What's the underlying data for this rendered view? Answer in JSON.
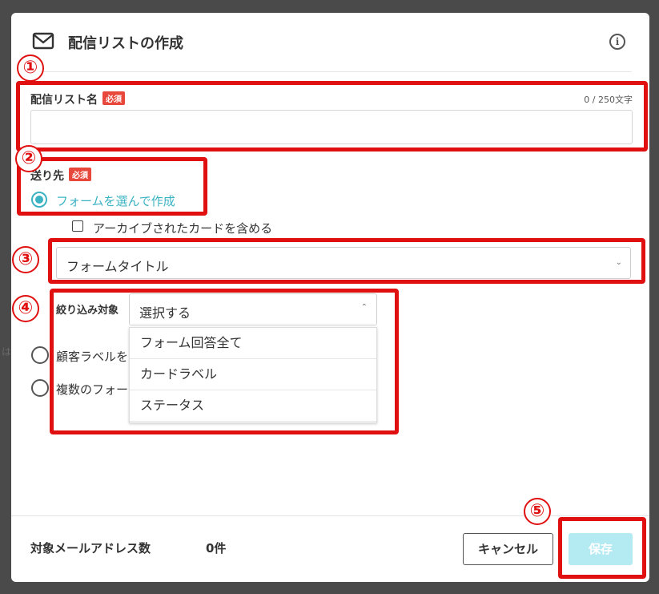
{
  "modal": {
    "title": "配信リストの作成",
    "icons": {
      "header": "mail-icon",
      "info": "info-icon"
    }
  },
  "list_name": {
    "label": "配信リスト名",
    "required_badge": "必須",
    "counter": "0 / 250文字",
    "value": ""
  },
  "recipients": {
    "label": "送り先",
    "required_badge": "必須",
    "options": [
      {
        "label": "フォームを選んで作成",
        "selected": true
      },
      {
        "label": "顧客ラベルを",
        "selected": false
      },
      {
        "label": "複数のフォー",
        "selected": false
      }
    ],
    "archive_checkbox": {
      "label": "アーカイブされたカードを含める",
      "checked": false
    }
  },
  "form_select": {
    "value": "フォームタイトル"
  },
  "filter": {
    "label": "絞り込み対象",
    "selected": "選択する",
    "options": [
      "フォーム回答全て",
      "カードラベル",
      "ステータス"
    ]
  },
  "footer": {
    "count_label": "対象メールアドレス数",
    "count_value": "0件",
    "cancel_label": "キャンセル",
    "save_label": "保存"
  },
  "annotations": [
    "①",
    "②",
    "③",
    "④",
    "⑤"
  ],
  "colors": {
    "accent": "#3bb3c3",
    "required": "#e8473b",
    "annotation": "#e01010",
    "save_disabled": "#b4ebf3"
  }
}
